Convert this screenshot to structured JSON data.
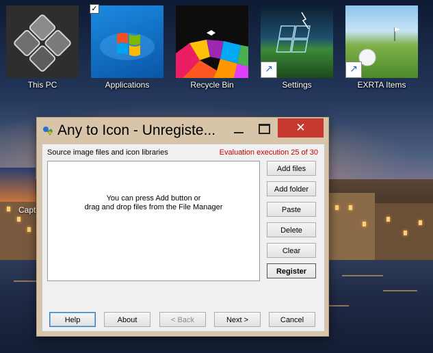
{
  "desktop": {
    "icons": [
      {
        "label": "This PC",
        "icon": "this-pc-icon"
      },
      {
        "label": "Applications",
        "icon": "windows-logo-icon",
        "checked": true
      },
      {
        "label": "Recycle Bin",
        "icon": "colorful-cubes-icon"
      },
      {
        "label": "Settings",
        "icon": "window-landscape-icon",
        "shortcut": true
      },
      {
        "label": "EXRTA Items",
        "icon": "golf-ball-icon",
        "shortcut": true
      }
    ],
    "partial_icon_label": "Capt"
  },
  "dialog": {
    "title": "Any to Icon - Unregiste...",
    "close_glyph": "✕",
    "source_label": "Source image files and icon libraries",
    "evaluation_text": "Evaluation execution 25 of 30",
    "drop_hint_line1": "You can press Add button or",
    "drop_hint_line2": "drag and drop files from the File Manager",
    "side_buttons": {
      "add_files": "Add files",
      "add_folder": "Add folder",
      "paste": "Paste",
      "delete": "Delete",
      "clear": "Clear",
      "register": "Register"
    },
    "bottom_buttons": {
      "help": "Help",
      "about": "About",
      "back": "< Back",
      "next": "Next >",
      "cancel": "Cancel"
    }
  },
  "colors": {
    "close_red": "#c7392f",
    "evaluation_red": "#c00000",
    "dialog_frame": "#d8c4a8"
  }
}
